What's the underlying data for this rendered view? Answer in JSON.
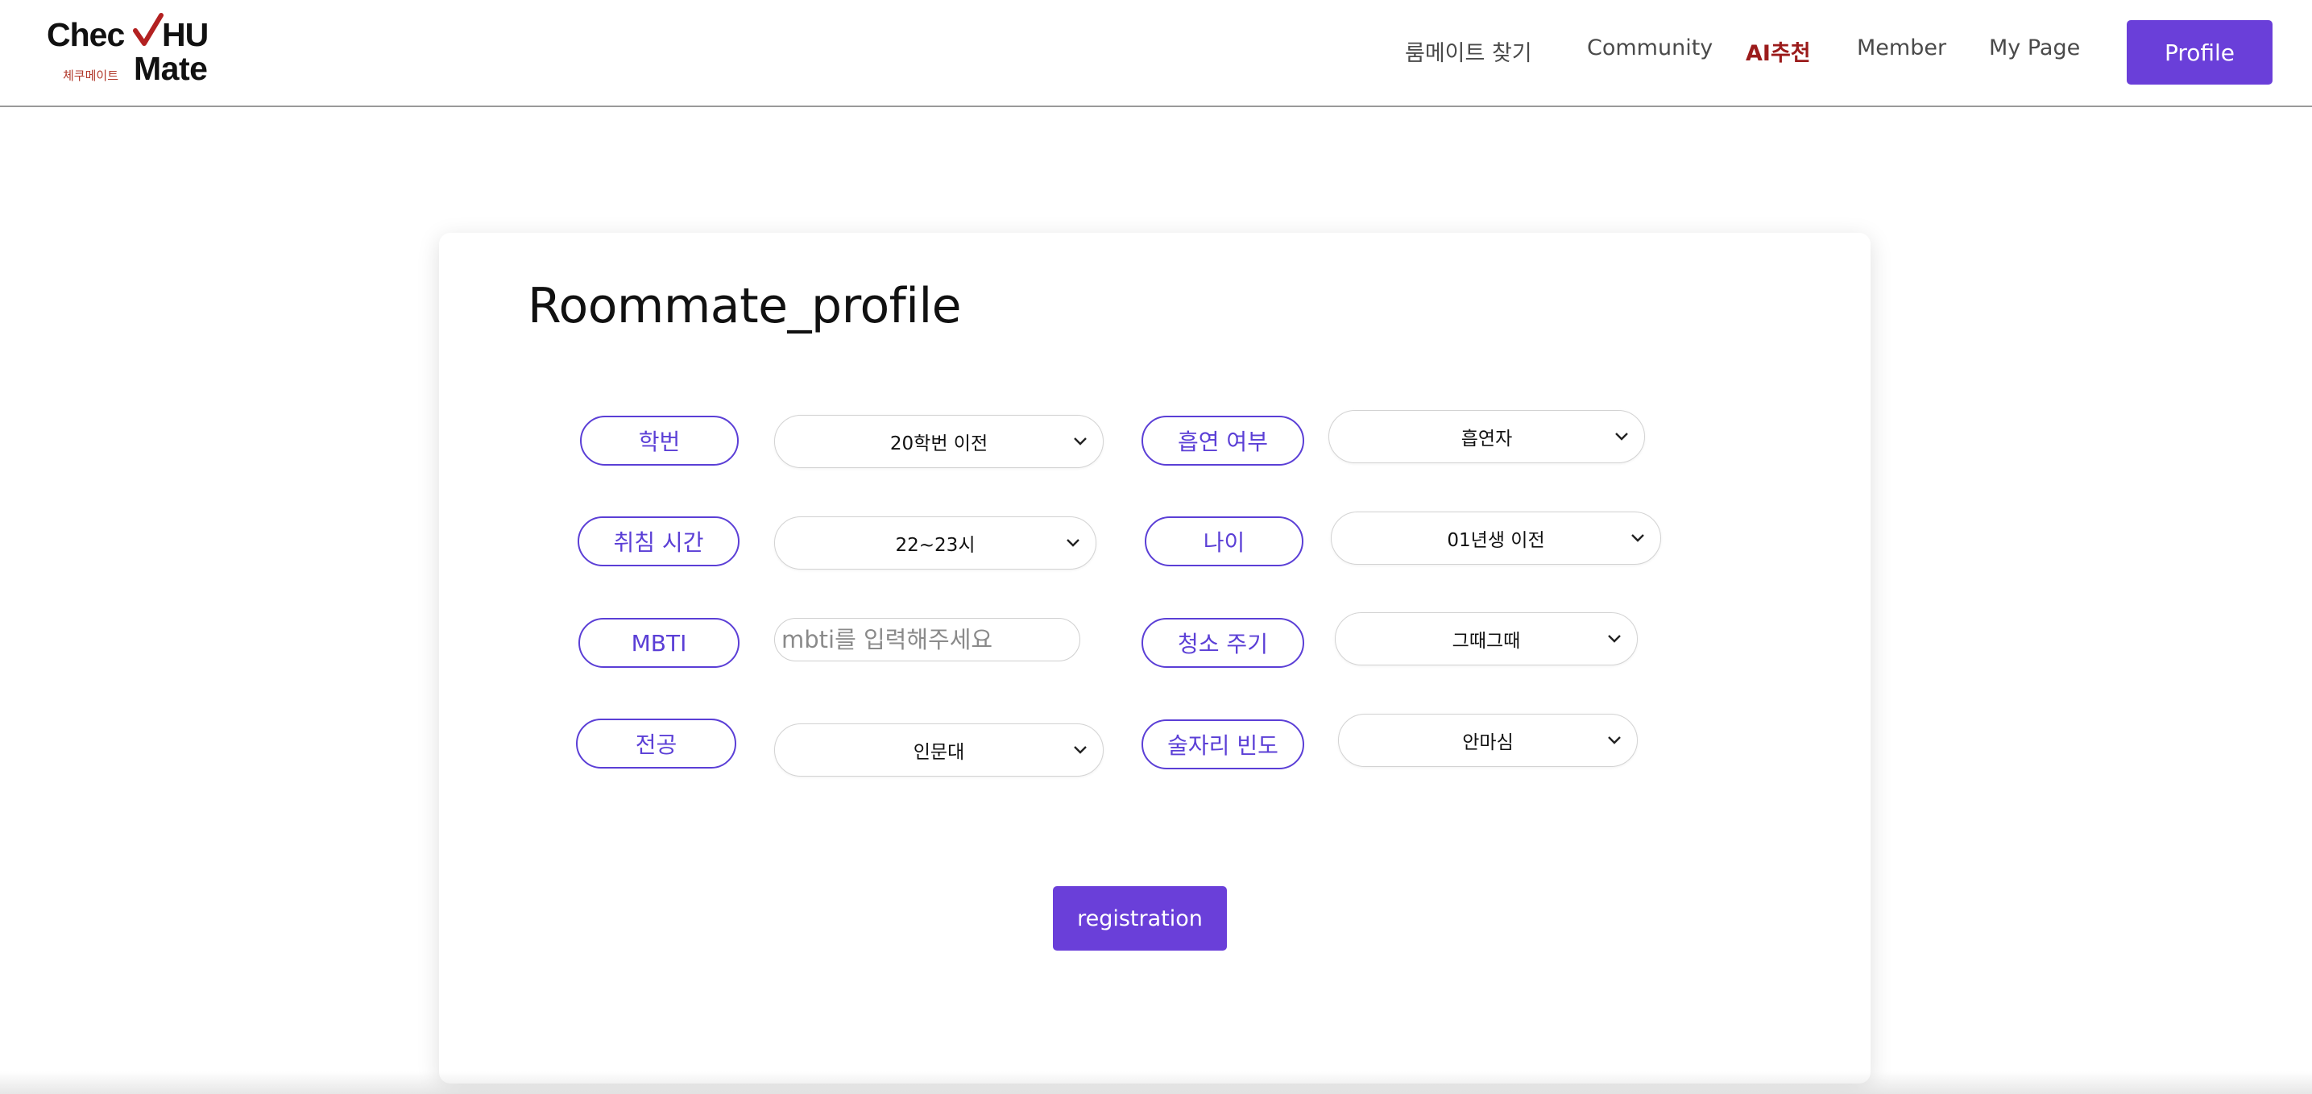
{
  "logo": {
    "text_top": "Chec",
    "text_top_suffix": "HU",
    "subtitle": "체쿠메이트",
    "text_bottom": "Mate",
    "check_icon": "checkmark-icon",
    "accent_color": "#b32121"
  },
  "nav": {
    "items": [
      {
        "label": "룸메이트 찾기",
        "active": false
      },
      {
        "label": "Community",
        "active": false
      },
      {
        "label": "AI추천",
        "active": true
      },
      {
        "label": "Member",
        "active": false
      },
      {
        "label": "My Page",
        "active": false
      }
    ],
    "profile_button": "Profile"
  },
  "colors": {
    "primary": "#6a3fd9",
    "pill_border": "#5b3fd6",
    "active_nav": "#9b1b1b"
  },
  "form": {
    "title": "Roommate_profile",
    "fields": {
      "student_id": {
        "label": "학번",
        "value": "20학번 이전"
      },
      "smoking": {
        "label": "흡연 여부",
        "value": "흡연자"
      },
      "bedtime": {
        "label": "취침 시간",
        "value": "22~23시"
      },
      "age": {
        "label": "나이",
        "value": "01년생 이전"
      },
      "mbti": {
        "label": "MBTI",
        "value": "",
        "placeholder": "mbti를 입력해주세요"
      },
      "cleaning": {
        "label": "청소 주기",
        "value": "그때그때"
      },
      "major": {
        "label": "전공",
        "value": "인문대"
      },
      "drinking": {
        "label": "술자리 빈도",
        "value": "안마심"
      }
    },
    "submit_label": "registration"
  }
}
